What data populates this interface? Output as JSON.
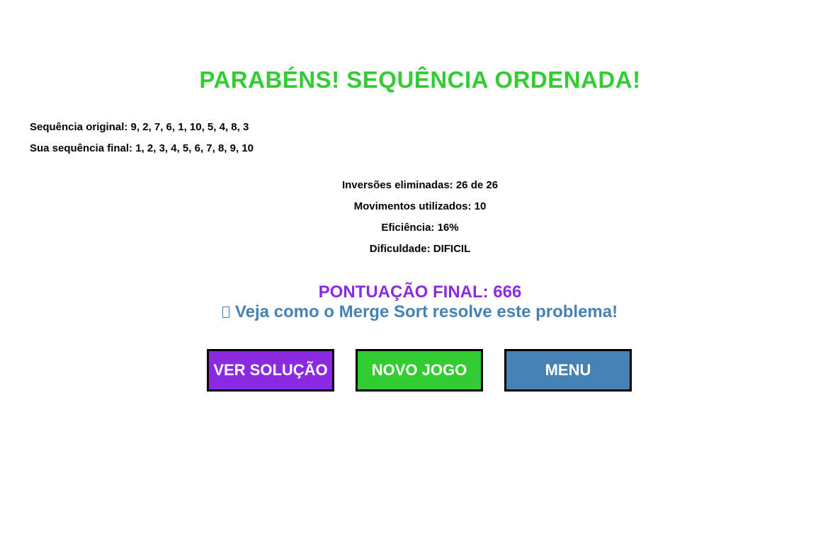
{
  "title": "PARABÉNS! SEQUÊNCIA ORDENADA!",
  "sequences": {
    "original": "Sequência original: 9, 2, 7, 6, 1, 10, 5, 4, 8, 3",
    "final": "Sua sequência final: 1, 2, 3, 4, 5, 6, 7, 8, 9, 10"
  },
  "stats": {
    "inversions": "Inversões eliminadas: 26 de 26",
    "moves": "Movimentos utilizados: 10",
    "efficiency": "Eficiência: 16%",
    "difficulty": "Dificuldade: DIFICIL"
  },
  "score": "PONTUAÇÃO FINAL: 666",
  "hint": {
    "icon": "missing-glyph-icon",
    "text": "Veja como o Merge Sort resolve este problema!"
  },
  "buttons": {
    "solution": "VER SOLUÇÃO",
    "new_game": "NOVO JOGO",
    "menu": "MENU"
  },
  "colors": {
    "title": "#33cc33",
    "score": "#8a2be2",
    "hint": "#4682b4",
    "solution_button": "#8a2be2",
    "new_game_button": "#33cc33",
    "menu_button": "#4682b4"
  }
}
